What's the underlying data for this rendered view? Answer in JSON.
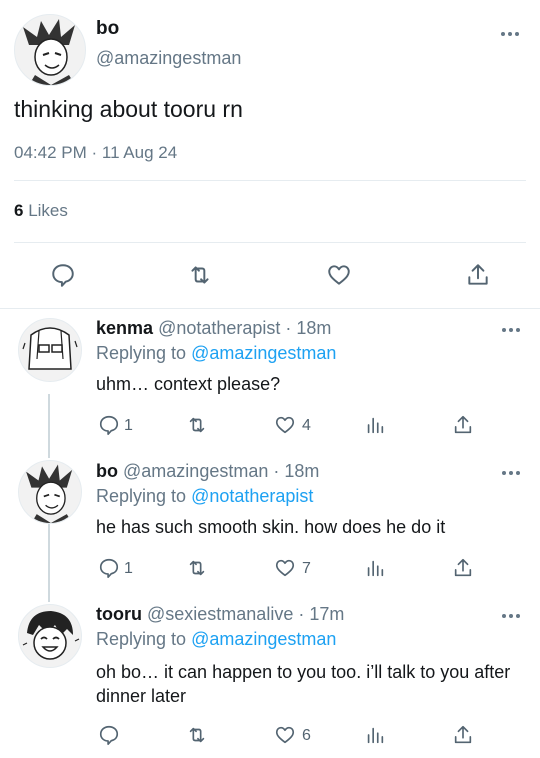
{
  "tweet": {
    "name": "bo",
    "handle": "@amazingestman",
    "text": "thinking about tooru rn",
    "timestamp": "04:42 PM · 11 Aug 24",
    "likes_count": "6",
    "likes_label": "Likes"
  },
  "replies": [
    {
      "name": "kenma",
      "handle": "@notatherapist · 18m",
      "replying_label": "Replying to",
      "replying_to": "@amazingestman",
      "text": "uhm… context please?",
      "reply_count": "1",
      "like_count": "4"
    },
    {
      "name": "bo",
      "handle": "@amazingestman · 18m",
      "replying_label": "Replying to",
      "replying_to": "@notatherapist",
      "text": "he has such smooth skin. how does he do it",
      "reply_count": "1",
      "like_count": "7"
    },
    {
      "name": "tooru",
      "handle": "@sexiestmanalive · 17m",
      "replying_label": "Replying to",
      "replying_to": "@amazingestman",
      "text": "oh bo… it can happen to you too. i’ll talk to you after dinner later",
      "reply_count": "",
      "like_count": "6"
    }
  ],
  "icons": {
    "reply": "speech-bubble-icon",
    "retweet": "retweet-arrows-icon",
    "like": "heart-icon",
    "analytics": "bar-chart-icon",
    "share": "upload-arrow-icon",
    "more": "three-dots-icon"
  },
  "colors": {
    "text": "#14171a",
    "muted": "#657786",
    "link": "#1da1f2",
    "divider": "#e6ecf0"
  }
}
